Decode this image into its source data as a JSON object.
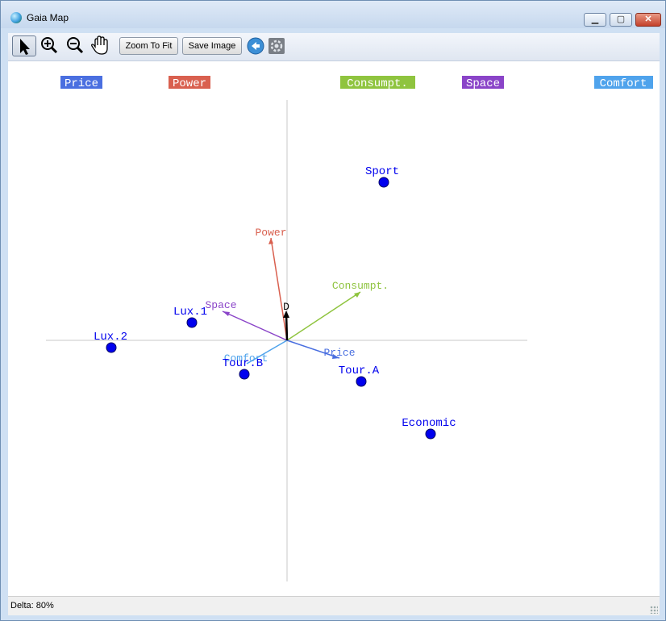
{
  "window": {
    "title": "Gaia Map"
  },
  "toolbar": {
    "zoom_to_fit_label": "Zoom To Fit",
    "save_image_label": "Save Image"
  },
  "legend": [
    {
      "label": "Price",
      "color": "#4a6fe0"
    },
    {
      "label": "Power",
      "color": "#d9604f"
    },
    {
      "label": "Consumpt.",
      "color": "#8fc43f"
    },
    {
      "label": "Space",
      "color": "#8a44c8"
    },
    {
      "label": "Comfort",
      "color": "#4fa3ec"
    }
  ],
  "map": {
    "criteria": [
      {
        "label": "Power",
        "color": "#d9604f"
      },
      {
        "label": "Consumpt.",
        "color": "#8fc43f"
      },
      {
        "label": "Space",
        "color": "#8a44c8"
      },
      {
        "label": "Comfort",
        "color": "#4fa3ec"
      },
      {
        "label": "Price",
        "color": "#4a6fe0"
      }
    ],
    "decision_axis_label": "D",
    "alternatives": [
      {
        "label": "Sport"
      },
      {
        "label": "Lux.1"
      },
      {
        "label": "Lux.2"
      },
      {
        "label": "Tour.B"
      },
      {
        "label": "Tour.A"
      },
      {
        "label": "Economic"
      }
    ],
    "alternative_color": "#0000ee"
  },
  "status": {
    "delta": "Delta: 80%"
  }
}
